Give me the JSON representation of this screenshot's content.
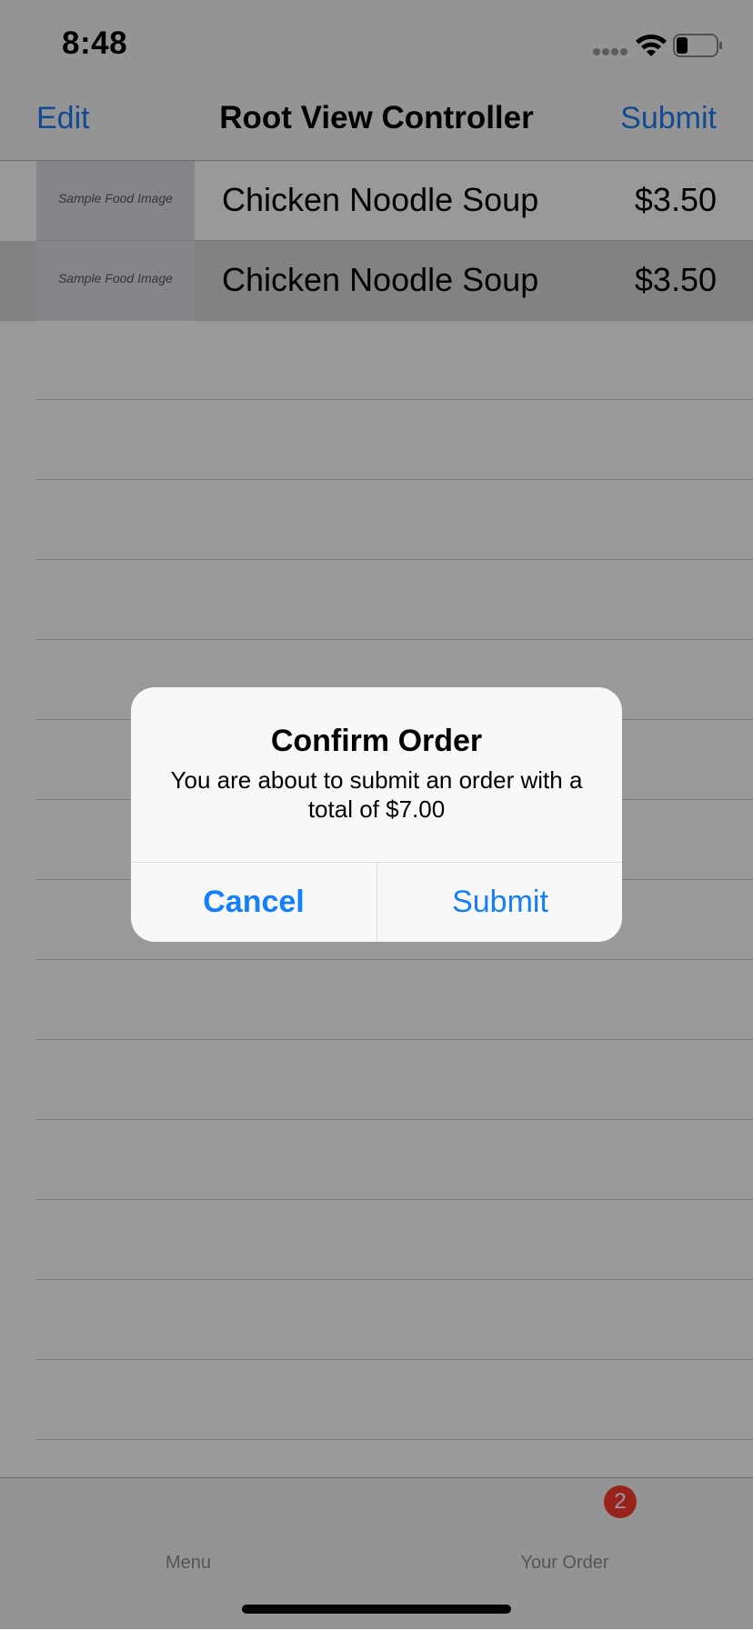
{
  "status_bar": {
    "time": "8:48"
  },
  "nav": {
    "left_label": "Edit",
    "title": "Root View Controller",
    "right_label": "Submit"
  },
  "rows": [
    {
      "thumbnail_text": "Sample Food Image",
      "name": "Chicken Noodle Soup",
      "price": "$3.50",
      "selected": false
    },
    {
      "thumbnail_text": "Sample Food Image",
      "name": "Chicken Noodle Soup",
      "price": "$3.50",
      "selected": true
    }
  ],
  "tabs": [
    {
      "label": "Menu",
      "icon": "menu-tab-icon"
    },
    {
      "label": "Your Order",
      "icon": "order-tab-icon",
      "badge": "2"
    }
  ],
  "alert": {
    "title": "Confirm Order",
    "message": "You are about to submit an order with a total of $7.00",
    "cancel_label": "Cancel",
    "submit_label": "Submit"
  },
  "colors": {
    "tint": "#1e7cf6",
    "badge": "#ff3b30",
    "dim_overlay": "rgba(0,0,0,0.4)"
  }
}
